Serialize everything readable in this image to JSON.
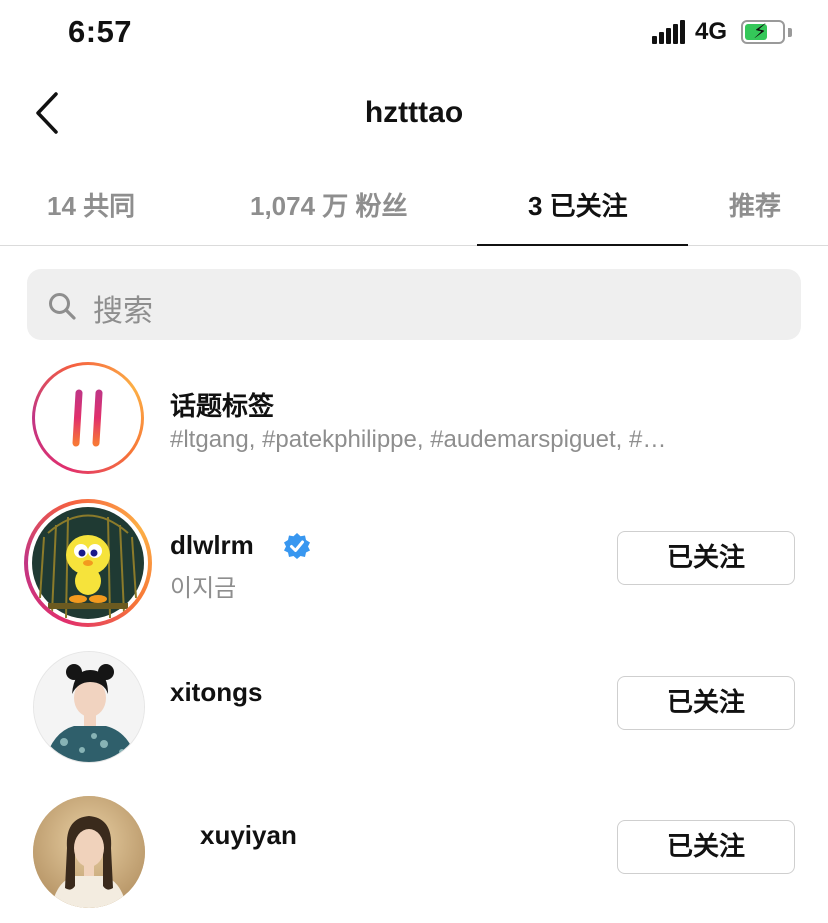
{
  "status_bar": {
    "time": "6:57",
    "network": "4G",
    "battery_level": 0.6,
    "battery_color": "#34c759"
  },
  "header": {
    "title": "hztttao",
    "back_icon": "chevron-left-icon"
  },
  "tabs": [
    {
      "label": "14 共同",
      "active": false
    },
    {
      "label": "1,074 万 粉丝",
      "active": false
    },
    {
      "label": "3 已关注",
      "active": true
    },
    {
      "label": "推荐",
      "active": false
    }
  ],
  "search": {
    "placeholder": "搜索",
    "icon": "search-icon"
  },
  "hashtags": {
    "title": "话题标签",
    "tags": "#ltgang, #patekphilippe, #audemarspiguet, #…",
    "icon": "hashtag-icon"
  },
  "following": [
    {
      "username": "dlwlrm",
      "display_name": "이지금",
      "verified": true,
      "button": "已关注",
      "has_story": true
    },
    {
      "username": "xitongs",
      "display_name": "",
      "verified": false,
      "button": "已关注",
      "has_story": false
    },
    {
      "username": "xuyiyan",
      "display_name": "",
      "verified": false,
      "button": "已关注",
      "has_story": false
    }
  ],
  "colors": {
    "accent_verified": "#3897f0",
    "muted_text": "#8e8e8e"
  }
}
